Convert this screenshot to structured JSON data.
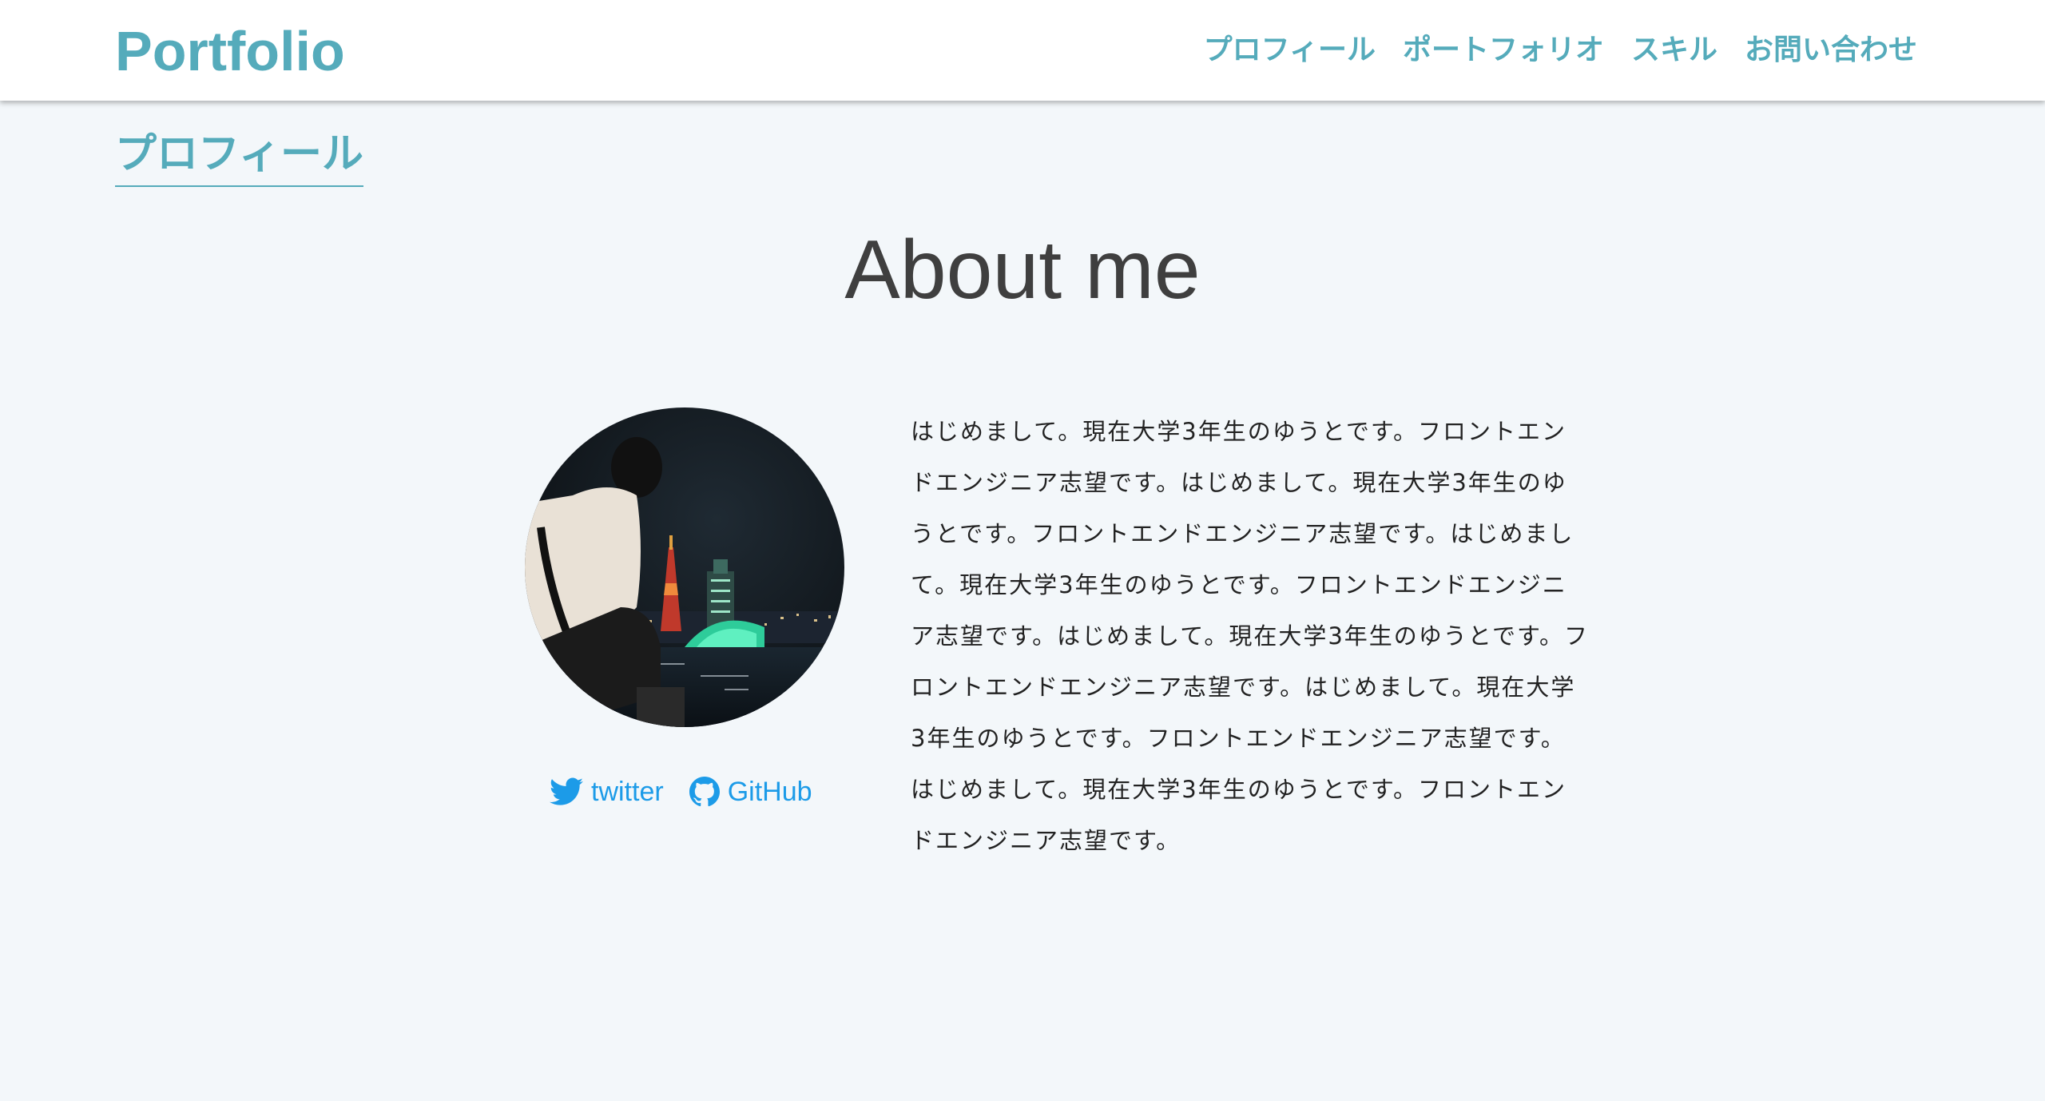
{
  "header": {
    "brand": "Portfolio",
    "nav": [
      {
        "label": "プロフィール"
      },
      {
        "label": "ポートフォリオ"
      },
      {
        "label": "スキル"
      },
      {
        "label": "お問い合わせ"
      }
    ]
  },
  "section": {
    "label": "プロフィール",
    "title": "About me"
  },
  "profile": {
    "social": [
      {
        "label": "twitter",
        "icon": "twitter-icon"
      },
      {
        "label": "GitHub",
        "icon": "github-icon"
      }
    ],
    "bio": "はじめまして。現在大学3年生のゆうとです。フロントエンドエンジニア志望です。はじめまして。現在大学3年生のゆうとです。フロントエンドエンジニア志望です。はじめまして。現在大学3年生のゆうとです。フロントエンドエンジニア志望です。はじめまして。現在大学3年生のゆうとです。フロントエンドエンジニア志望です。はじめまして。現在大学3年生のゆうとです。フロントエンドエンジニア志望です。はじめまして。現在大学3年生のゆうとです。フロントエンドエンジニア志望です。"
  },
  "colors": {
    "accent": "#55abbb",
    "link": "#1c9be8",
    "background": "#f3f7fa",
    "title": "#3f3f3f"
  }
}
